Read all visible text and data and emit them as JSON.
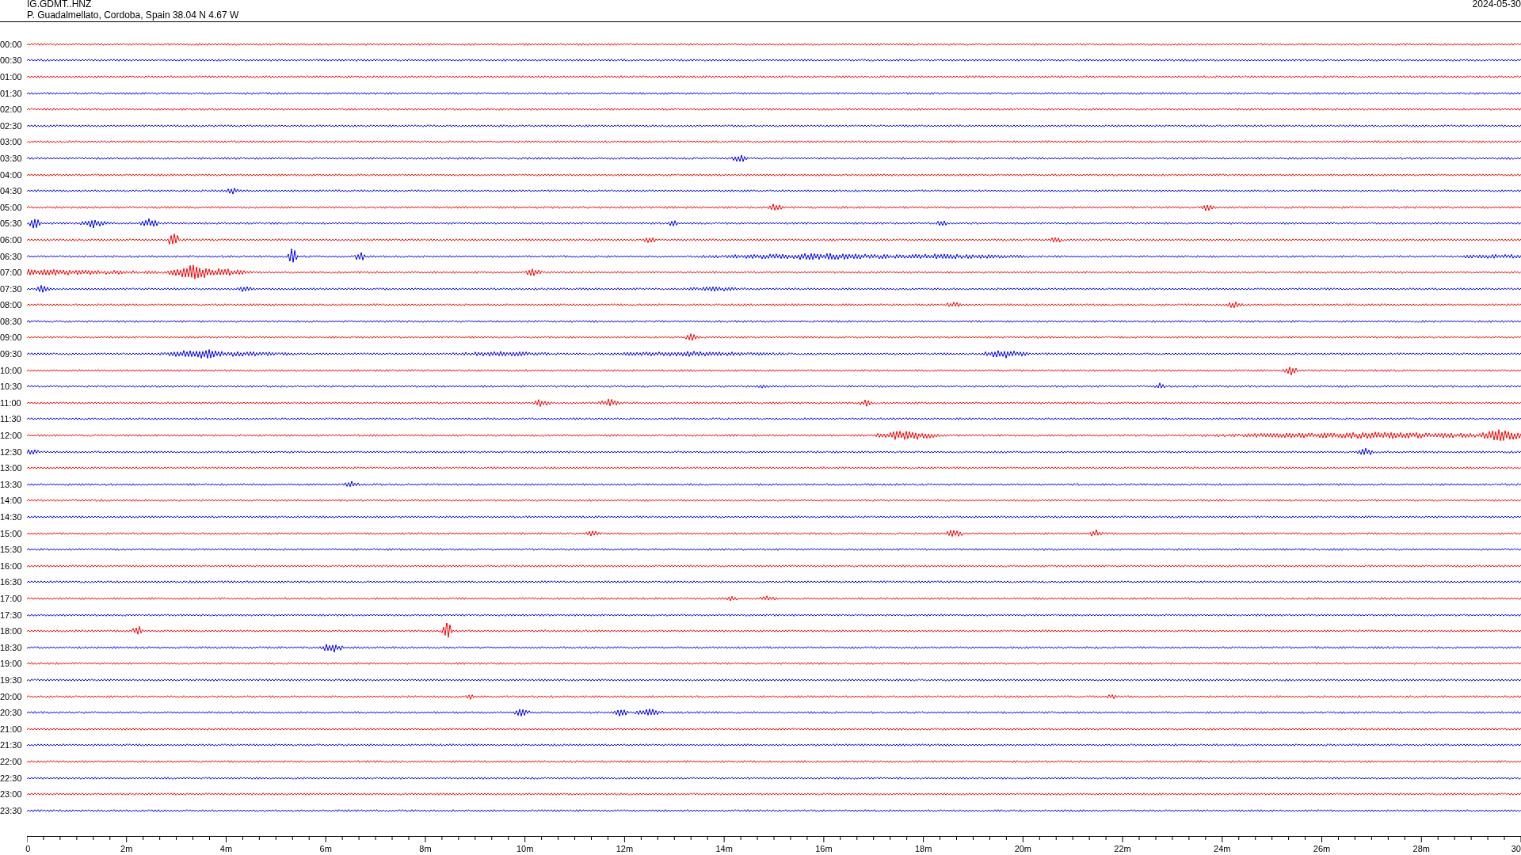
{
  "header": {
    "station": "IG.GDMT..HNZ",
    "location": "P. Guadalmellato, Cordoba, Spain  38.04 N 4.67 W",
    "date": "2024-05-30"
  },
  "traces": [
    {
      "time": "00:00",
      "color": "#ff0000"
    },
    {
      "time": "00:30",
      "color": "#0000ff"
    },
    {
      "time": "01:00",
      "color": "#ff0000"
    },
    {
      "time": "01:30",
      "color": "#0000ff"
    },
    {
      "time": "02:00",
      "color": "#ff0000"
    },
    {
      "time": "02:30",
      "color": "#0000ff"
    },
    {
      "time": "03:00",
      "color": "#ff0000"
    },
    {
      "time": "03:30",
      "color": "#0000ff"
    },
    {
      "time": "04:00",
      "color": "#ff0000"
    },
    {
      "time": "04:30",
      "color": "#0000ff"
    },
    {
      "time": "05:00",
      "color": "#ff0000"
    },
    {
      "time": "05:30",
      "color": "#0000ff"
    },
    {
      "time": "06:00",
      "color": "#ff0000"
    },
    {
      "time": "06:30",
      "color": "#0000ff"
    },
    {
      "time": "07:00",
      "color": "#ff0000"
    },
    {
      "time": "07:30",
      "color": "#0000ff"
    },
    {
      "time": "08:00",
      "color": "#ff0000"
    },
    {
      "time": "08:30",
      "color": "#0000ff"
    },
    {
      "time": "09:00",
      "color": "#ff0000"
    },
    {
      "time": "09:30",
      "color": "#0000ff"
    },
    {
      "time": "10:00",
      "color": "#ff0000"
    },
    {
      "time": "10:30",
      "color": "#0000ff"
    },
    {
      "time": "11:00",
      "color": "#ff0000"
    },
    {
      "time": "11:30",
      "color": "#0000ff"
    },
    {
      "time": "12:00",
      "color": "#ff0000"
    },
    {
      "time": "12:30",
      "color": "#0000ff"
    },
    {
      "time": "13:00",
      "color": "#ff0000"
    },
    {
      "time": "13:30",
      "color": "#0000ff"
    },
    {
      "time": "14:00",
      "color": "#ff0000"
    },
    {
      "time": "14:30",
      "color": "#0000ff"
    },
    {
      "time": "15:00",
      "color": "#ff0000"
    },
    {
      "time": "15:30",
      "color": "#0000ff"
    },
    {
      "time": "16:00",
      "color": "#ff0000"
    },
    {
      "time": "16:30",
      "color": "#0000ff"
    },
    {
      "time": "17:00",
      "color": "#ff0000"
    },
    {
      "time": "17:30",
      "color": "#0000ff"
    },
    {
      "time": "18:00",
      "color": "#ff0000"
    },
    {
      "time": "18:30",
      "color": "#0000ff"
    },
    {
      "time": "19:00",
      "color": "#ff0000"
    },
    {
      "time": "19:30",
      "color": "#0000ff"
    },
    {
      "time": "20:00",
      "color": "#ff0000"
    },
    {
      "time": "20:30",
      "color": "#0000ff"
    },
    {
      "time": "21:00",
      "color": "#ff0000"
    },
    {
      "time": "21:30",
      "color": "#0000ff"
    },
    {
      "time": "22:00",
      "color": "#ff0000"
    },
    {
      "time": "22:30",
      "color": "#0000ff"
    },
    {
      "time": "23:00",
      "color": "#ff0000"
    },
    {
      "time": "23:30",
      "color": "#0000ff"
    }
  ],
  "time_axis": {
    "tick_labels": [
      "0",
      "2m",
      "4m",
      "6m",
      "8m",
      "10m",
      "12m",
      "14m",
      "16m",
      "18m",
      "20m",
      "22m",
      "24m",
      "26m",
      "28m",
      "30"
    ]
  }
}
